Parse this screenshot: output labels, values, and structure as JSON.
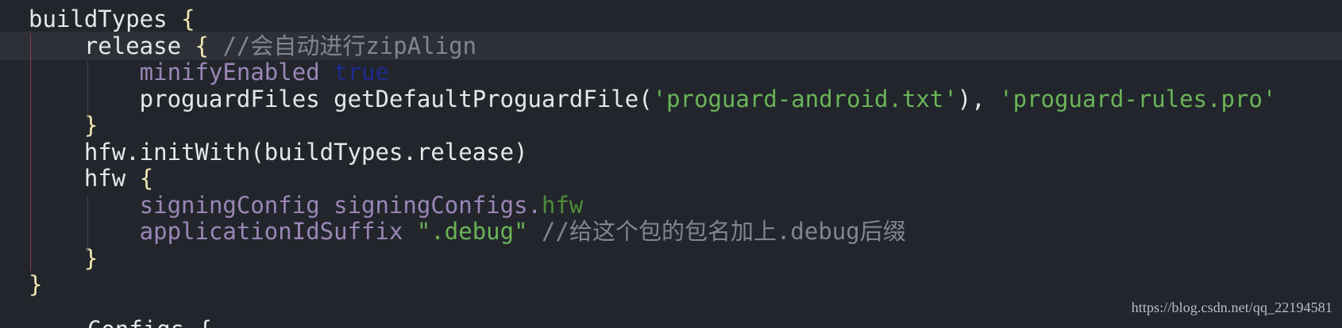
{
  "colors": {
    "background": "#22262c",
    "current_line": "#2e3038",
    "plain": "#e6e7e9",
    "brace": "#f1e6b3",
    "comment": "#7e8791",
    "property": "#9b86b6",
    "keyword": "#1f2a8f",
    "string": "#6ab457",
    "reference": "#4e8b3a",
    "watermark": "#b9bec7",
    "guide": "#3d434d",
    "guide_red": "#8a3c4a",
    "gutter_marker": "#d9b85f"
  },
  "code": {
    "lines": [
      {
        "tokens": [
          {
            "text": "buildTypes ",
            "kind": "plain"
          },
          {
            "text": "{",
            "kind": "brace"
          }
        ]
      },
      {
        "current": true,
        "tokens": [
          {
            "text": "    release ",
            "kind": "plain"
          },
          {
            "text": "{",
            "kind": "brace"
          },
          {
            "text": " //会自动进行zipAlign",
            "kind": "comment"
          }
        ]
      },
      {
        "tokens": [
          {
            "text": "        minifyEnabled",
            "kind": "prop"
          },
          {
            "text": " ",
            "kind": "plain"
          },
          {
            "text": "true",
            "kind": "keyword"
          }
        ]
      },
      {
        "tokens": [
          {
            "text": "        proguardFiles getDefaultProguardFile(",
            "kind": "plain"
          },
          {
            "text": "'proguard-android.txt'",
            "kind": "string"
          },
          {
            "text": "), ",
            "kind": "plain"
          },
          {
            "text": "'proguard-rules.pro'",
            "kind": "string"
          }
        ]
      },
      {
        "tokens": [
          {
            "text": "    ",
            "kind": "plain"
          },
          {
            "text": "}",
            "kind": "brace"
          }
        ]
      },
      {
        "tokens": [
          {
            "text": "    hfw.initWith(buildTypes.release)",
            "kind": "plain"
          }
        ]
      },
      {
        "tokens": [
          {
            "text": "    hfw ",
            "kind": "plain"
          },
          {
            "text": "{",
            "kind": "brace"
          }
        ]
      },
      {
        "tokens": [
          {
            "text": "        signingConfig signingConfigs.",
            "kind": "prop"
          },
          {
            "text": "hfw",
            "kind": "ref"
          }
        ]
      },
      {
        "tokens": [
          {
            "text": "        applicationIdSuffix ",
            "kind": "prop"
          },
          {
            "text": "\".debug\"",
            "kind": "string"
          },
          {
            "text": " //给这个包的包名加上.debug后缀",
            "kind": "comment"
          }
        ]
      },
      {
        "tokens": [
          {
            "text": "    ",
            "kind": "plain"
          },
          {
            "text": "}",
            "kind": "brace"
          }
        ]
      },
      {
        "tokens": [
          {
            "text": "}",
            "kind": "brace"
          }
        ]
      }
    ],
    "bottom_fragment": "Configs {"
  },
  "watermark": "https://blog.csdn.net/qq_22194581"
}
